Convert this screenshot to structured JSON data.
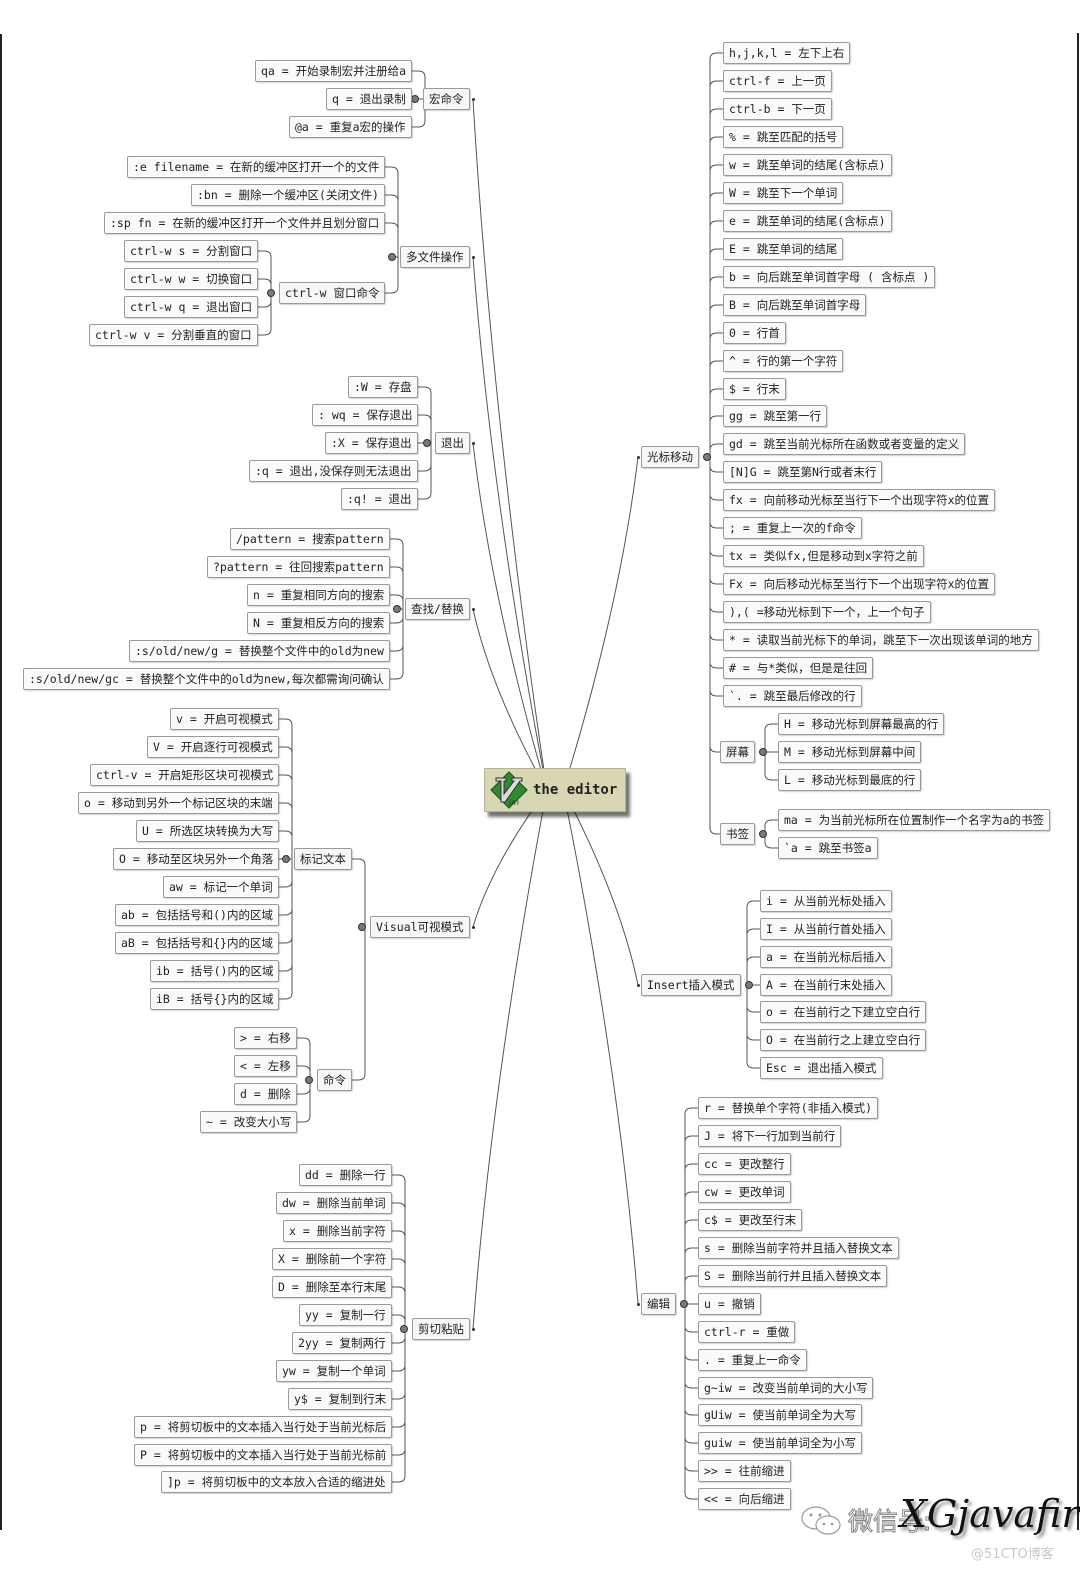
{
  "center": {
    "title": "the editor",
    "logo": "vim-logo-icon"
  },
  "colors": {
    "line": "#555555",
    "node_border": "#9a9a9a",
    "center_bg": "#d9d7b3",
    "knob": "#7a7a7a"
  },
  "left": [
    {
      "label": "宏命令",
      "children": [
        {
          "label": "qa = 开始录制宏并注册给a"
        },
        {
          "label": "q = 退出录制"
        },
        {
          "label": "@a = 重复a宏的操作"
        }
      ]
    },
    {
      "label": "多文件操作",
      "children": [
        {
          "label": ":e filename = 在新的缓冲区打开一个的文件"
        },
        {
          "label": ":bn = 删除一个缓冲区(关闭文件)"
        },
        {
          "label": ":sp fn = 在新的缓冲区打开一个文件并且划分窗口"
        },
        {
          "label": "ctrl-w 窗口命令",
          "children": [
            {
              "label": "ctrl-w s = 分割窗口"
            },
            {
              "label": "ctrl-w w = 切换窗口"
            },
            {
              "label": "ctrl-w q = 退出窗口"
            },
            {
              "label": "ctrl-w v = 分割垂直的窗口"
            }
          ]
        }
      ]
    },
    {
      "label": "退出",
      "children": [
        {
          "label": ":W = 存盘"
        },
        {
          "label": ": wq = 保存退出"
        },
        {
          "label": ":X = 保存退出"
        },
        {
          "label": ":q = 退出,没保存则无法退出"
        },
        {
          "label": ":q! = 退出"
        }
      ]
    },
    {
      "label": "查找/替换",
      "children": [
        {
          "label": "/pattern = 搜索pattern"
        },
        {
          "label": "?pattern = 往回搜索pattern"
        },
        {
          "label": "n = 重复相同方向的搜索"
        },
        {
          "label": "N = 重复相反方向的搜索"
        },
        {
          "label": ":s/old/new/g = 替换整个文件中的old为new"
        },
        {
          "label": ":s/old/new/gc = 替换整个文件中的old为new,每次都需询问确认"
        }
      ]
    },
    {
      "label": "Visual可视模式",
      "children": [
        {
          "label": "标记文本",
          "children": [
            {
              "label": "v = 开启可视模式"
            },
            {
              "label": "V = 开启逐行可视模式"
            },
            {
              "label": "ctrl-v = 开启矩形区块可视模式"
            },
            {
              "label": "o = 移动到另外一个标记区块的末端"
            },
            {
              "label": "U = 所选区块转换为大写"
            },
            {
              "label": "O = 移动至区块另外一个角落"
            },
            {
              "label": "aw = 标记一个单词"
            },
            {
              "label": "ab = 包括括号和()内的区域"
            },
            {
              "label": "aB = 包括括号和{}内的区域"
            },
            {
              "label": "ib = 括号()内的区域"
            },
            {
              "label": "iB = 括号{}内的区域"
            }
          ]
        },
        {
          "label": "命令",
          "children": [
            {
              "label": "> = 右移"
            },
            {
              "label": "< = 左移"
            },
            {
              "label": "d = 删除"
            },
            {
              "label": "~ = 改变大小写"
            }
          ]
        }
      ]
    },
    {
      "label": "剪切粘贴",
      "children": [
        {
          "label": "dd = 删除一行"
        },
        {
          "label": "dw = 删除当前单词"
        },
        {
          "label": "x = 删除当前字符"
        },
        {
          "label": "X = 删除前一个字符"
        },
        {
          "label": "D = 删除至本行末尾"
        },
        {
          "label": "yy = 复制一行"
        },
        {
          "label": "2yy = 复制两行"
        },
        {
          "label": "yw = 复制一个单词"
        },
        {
          "label": "y$ = 复制到行末"
        },
        {
          "label": "p = 将剪切板中的文本插入当行处于当前光标后"
        },
        {
          "label": "P = 将剪切板中的文本插入当行处于当前光标前"
        },
        {
          "label": "]p = 将剪切板中的文本放入合适的缩进处"
        }
      ]
    }
  ],
  "right": [
    {
      "label": "光标移动",
      "children": [
        {
          "label": "h,j,k,l = 左下上右"
        },
        {
          "label": "ctrl-f = 上一页"
        },
        {
          "label": "ctrl-b = 下一页"
        },
        {
          "label": "% = 跳至匹配的括号"
        },
        {
          "label": "w = 跳至单词的结尾(含标点)"
        },
        {
          "label": "W = 跳至下一个单词"
        },
        {
          "label": "e = 跳至单词的结尾(含标点)"
        },
        {
          "label": "E = 跳至单词的结尾"
        },
        {
          "label": "b = 向后跳至单词首字母 ( 含标点 )"
        },
        {
          "label": "B = 向后跳至单词首字母"
        },
        {
          "label": "0 = 行首"
        },
        {
          "label": "^ = 行的第一个字符"
        },
        {
          "label": "$ = 行末"
        },
        {
          "label": "gg = 跳至第一行"
        },
        {
          "label": "gd = 跳至当前光标所在函数或者变量的定义"
        },
        {
          "label": "[N]G = 跳至第N行或者末行"
        },
        {
          "label": "fx = 向前移动光标至当行下一个出现字符x的位置"
        },
        {
          "label": "; = 重复上一次的f命令"
        },
        {
          "label": "tx = 类似fx,但是移动到x字符之前"
        },
        {
          "label": "Fx = 向后移动光标至当行下一个出现字符x的位置"
        },
        {
          "label": "),( =移动光标到下一个，上一个句子"
        },
        {
          "label": "* = 读取当前光标下的单词，跳至下一次出现该单词的地方"
        },
        {
          "label": "# = 与*类似，但是是往回"
        },
        {
          "label": "`. = 跳至最后修改的行"
        },
        {
          "label": "屏幕",
          "children": [
            {
              "label": "H = 移动光标到屏幕最高的行"
            },
            {
              "label": "M = 移动光标到屏幕中间"
            },
            {
              "label": "L = 移动光标到最底的行"
            }
          ]
        },
        {
          "label": "书签",
          "children": [
            {
              "label": "ma = 为当前光标所在位置制作一个名字为a的书签"
            },
            {
              "label": "`a = 跳至书签a"
            }
          ]
        }
      ]
    },
    {
      "label": "Insert插入模式",
      "children": [
        {
          "label": "i = 从当前光标处插入"
        },
        {
          "label": "I = 从当前行首处插入"
        },
        {
          "label": "a = 在当前光标后插入"
        },
        {
          "label": "A = 在当前行末处插入"
        },
        {
          "label": "o = 在当前行之下建立空白行"
        },
        {
          "label": "O = 在当前行之上建立空白行"
        },
        {
          "label": "Esc = 退出插入模式"
        }
      ]
    },
    {
      "label": "编辑",
      "children": [
        {
          "label": "r = 替换单个字符(非插入模式)"
        },
        {
          "label": "J = 将下一行加到当前行"
        },
        {
          "label": "cc = 更改整行"
        },
        {
          "label": "cw = 更改单词"
        },
        {
          "label": "c$ = 更改至行末"
        },
        {
          "label": "s = 删除当前字符并且插入替换文本"
        },
        {
          "label": "S = 删除当前行并且插入替换文本"
        },
        {
          "label": "u = 撤销"
        },
        {
          "label": "ctrl-r = 重做"
        },
        {
          "label": ". = 重复上一命令"
        },
        {
          "label": "g~iw = 改变当前单词的大小写"
        },
        {
          "label": "gUiw = 使当前单词全为大写"
        },
        {
          "label": "guiw = 使当前单词全为小写"
        },
        {
          "label": ">> = 往前缩进"
        },
        {
          "label": "<< = 向后缩进"
        }
      ]
    }
  ],
  "watermark": {
    "text": "微信号:",
    "signature": "XGjavafirst",
    "icon": "wechat-icon"
  },
  "source_credit": "@51CTO博客"
}
